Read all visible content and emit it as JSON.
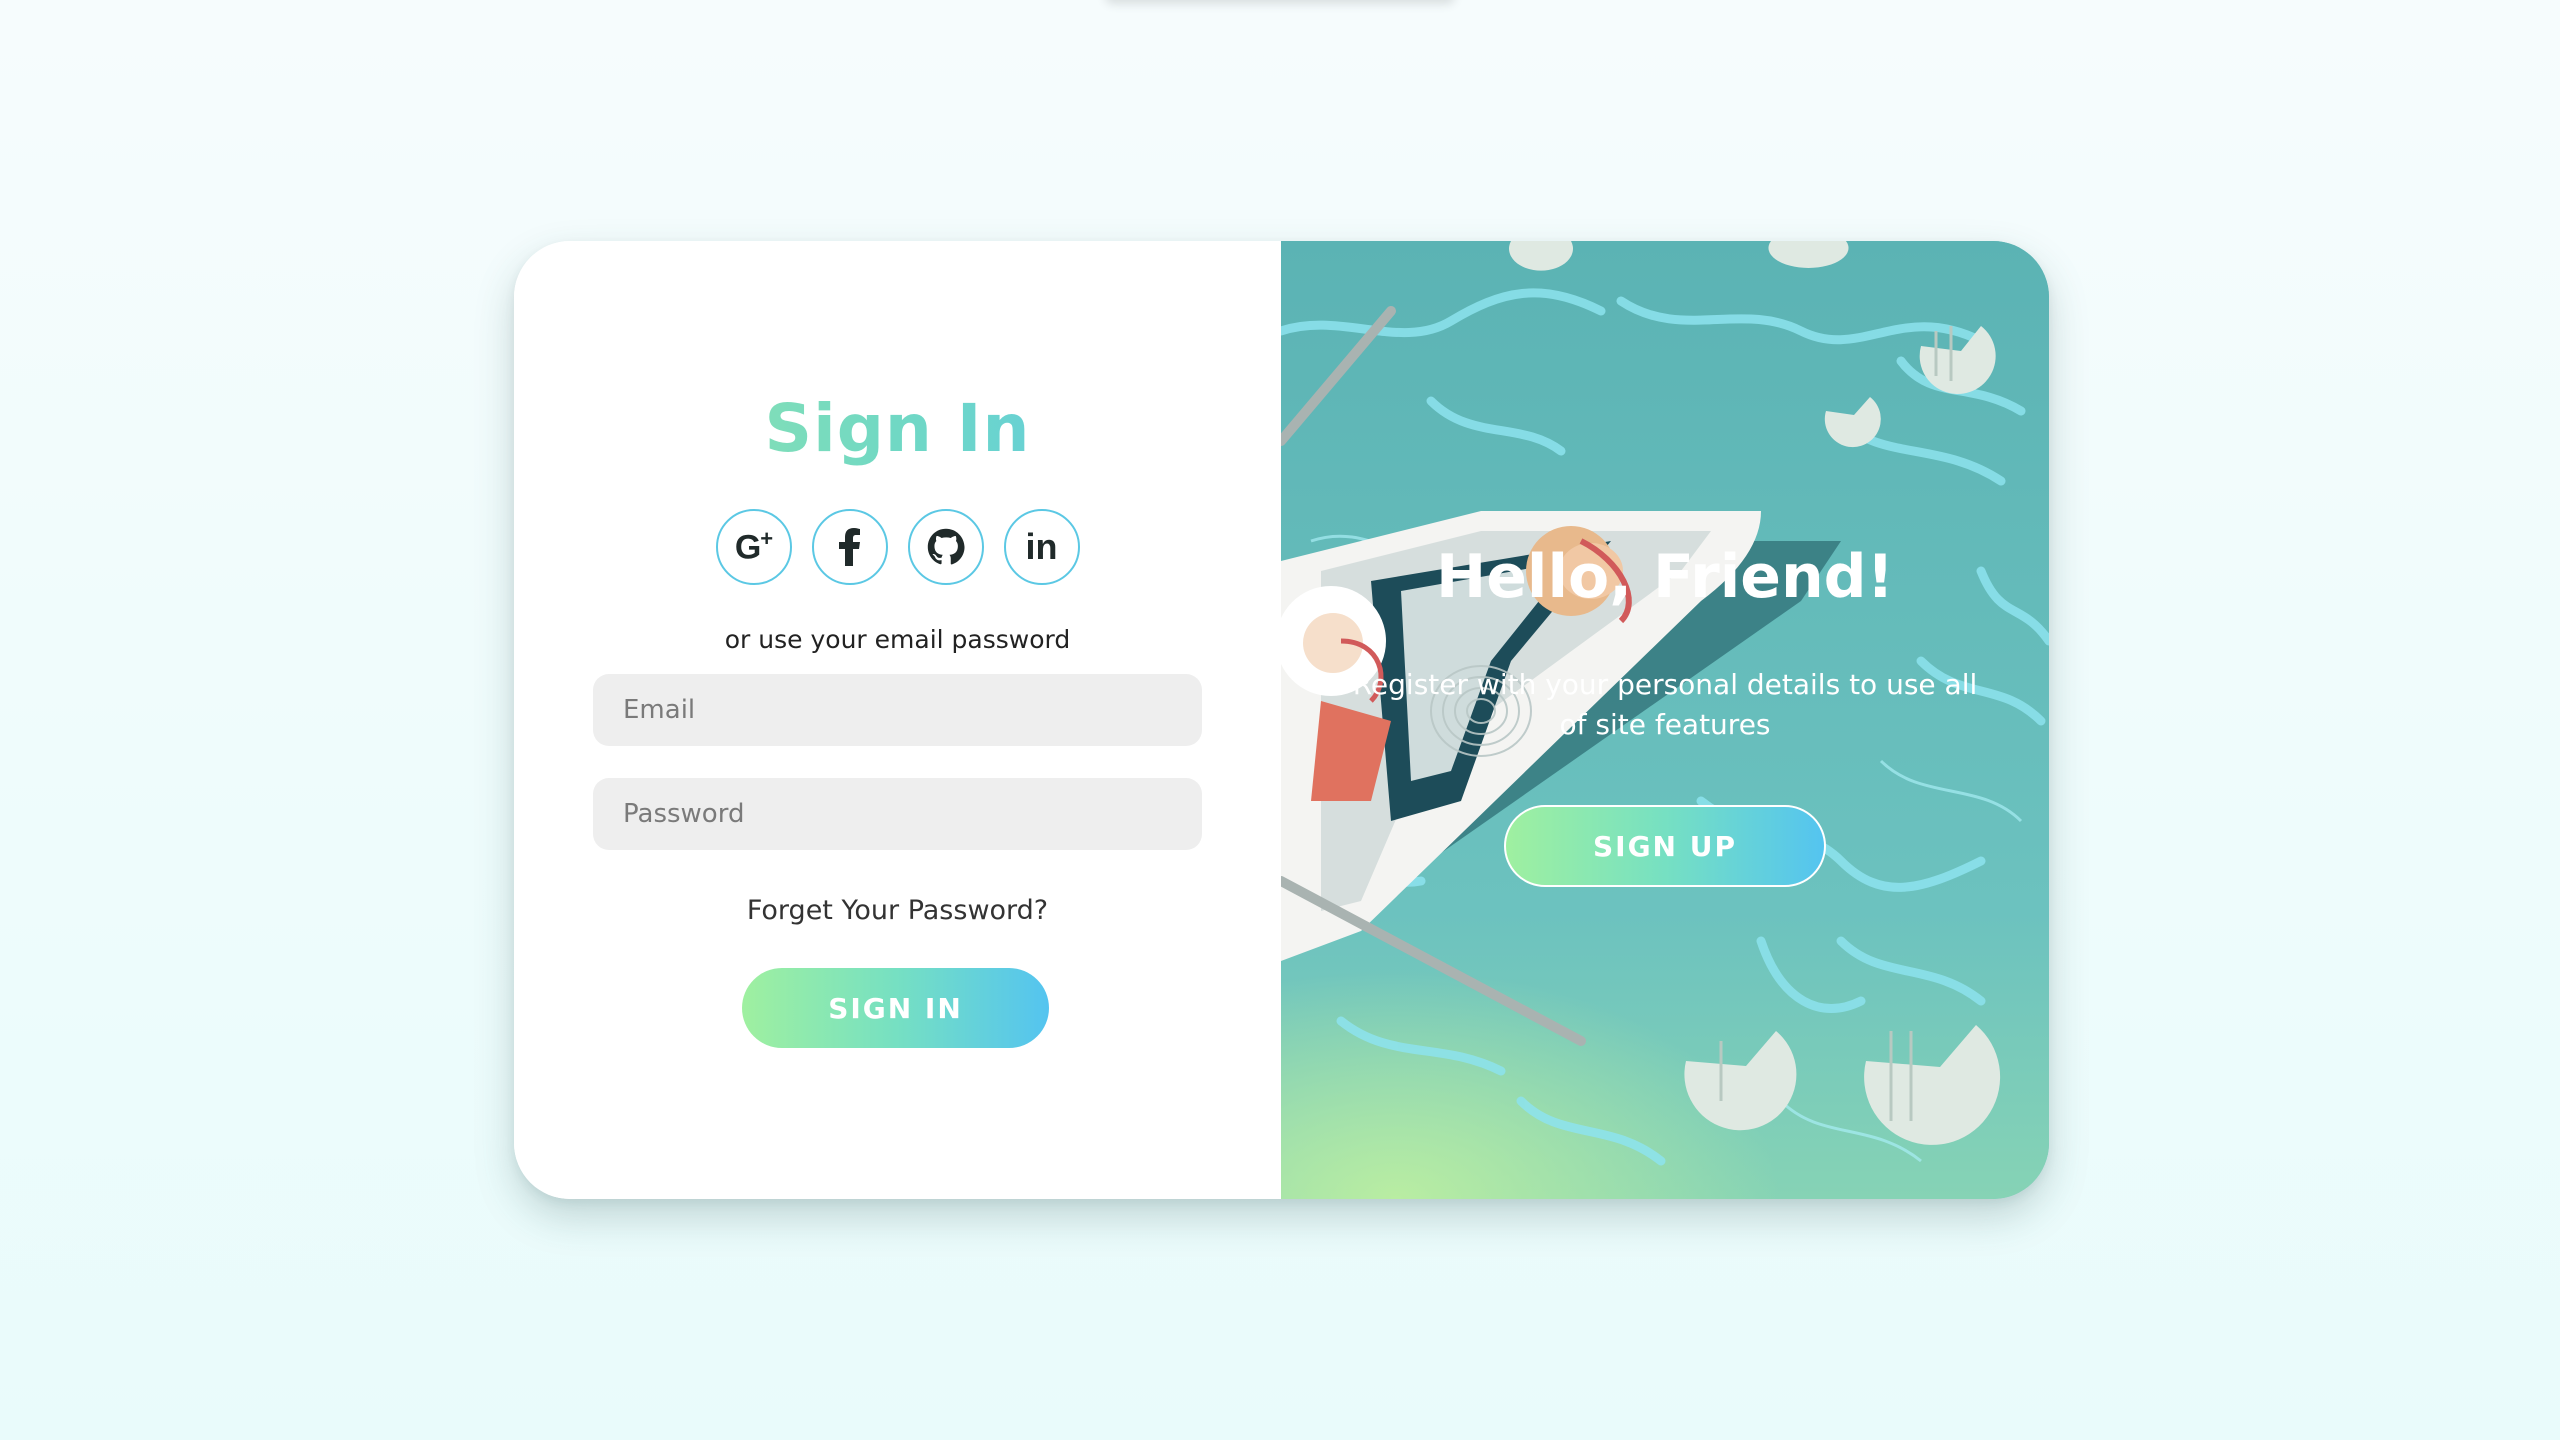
{
  "signin_panel": {
    "title": "Sign In",
    "socials": [
      {
        "name": "google-plus",
        "label": "G+"
      },
      {
        "name": "facebook",
        "label": "f"
      },
      {
        "name": "github",
        "label": "github"
      },
      {
        "name": "linkedin",
        "label": "in"
      }
    ],
    "subtext": "or use your email password",
    "email_placeholder": "Email",
    "password_placeholder": "Password",
    "forgot_link": "Forget Your Password?",
    "signin_button": "SIGN IN"
  },
  "signup_panel": {
    "title": "Hello, Friend!",
    "description": "Register with your personal details to use all of site features",
    "signup_button": "SIGN UP"
  },
  "colors": {
    "accent_green": "#9be8a6",
    "accent_blue": "#5ac6ef",
    "input_bg": "#eeeeee",
    "social_border": "#5bc8e4",
    "water": "#5fb6b6"
  }
}
